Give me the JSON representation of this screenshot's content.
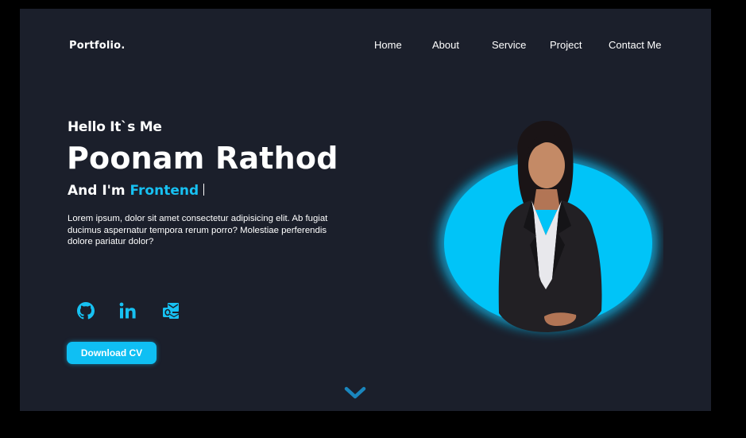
{
  "header": {
    "logo": "Portfolio."
  },
  "nav": {
    "items": [
      {
        "label": "Home"
      },
      {
        "label": "About"
      },
      {
        "label": "Service"
      },
      {
        "label": "Project"
      },
      {
        "label": "Contact Me"
      }
    ]
  },
  "hero": {
    "greeting": "Hello It`s Me",
    "name": "Poonam Rathod",
    "role_prefix": "And I'm",
    "role_highlight": "Frontend",
    "intro": "Lorem ipsum, dolor sit amet consectetur adipisicing elit. Ab fugiat ducimus aspernatur tempora rerum porro? Molestiae  perferendis dolore pariatur dolor?",
    "download_label": "Download CV"
  },
  "social": [
    {
      "icon": "github-icon"
    },
    {
      "icon": "linkedin-icon"
    },
    {
      "icon": "outlook-mail-icon"
    }
  ],
  "colors": {
    "background": "#1b1f2b",
    "outer": "#000000",
    "accent": "#0fbff3",
    "text": "#ffffff",
    "chevron": "#1a86bd"
  }
}
